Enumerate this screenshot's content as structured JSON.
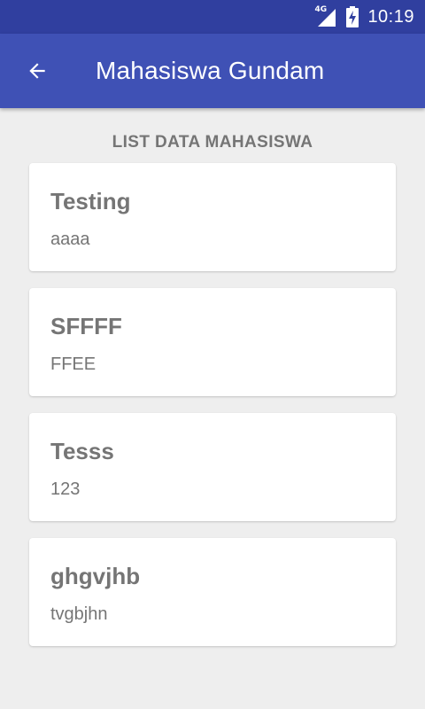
{
  "status_bar": {
    "network_label": "4G",
    "time": "10:19",
    "icons": [
      "signal-icon",
      "battery-charging-icon"
    ]
  },
  "app_bar": {
    "title": "Mahasiswa Gundam",
    "back_icon": "arrow-left-icon"
  },
  "list": {
    "heading": "LIST DATA MAHASISWA",
    "items": [
      {
        "name": "Testing",
        "detail": "aaaa"
      },
      {
        "name": "SFFFF",
        "detail": "FFEE"
      },
      {
        "name": "Tesss",
        "detail": "123"
      },
      {
        "name": "ghgvjhb",
        "detail": "tvgbjhn"
      }
    ]
  },
  "colors": {
    "status_bar": "#303f9f",
    "app_bar": "#3f51b5",
    "background": "#eeeeee",
    "card": "#ffffff",
    "text_secondary": "#757575"
  }
}
